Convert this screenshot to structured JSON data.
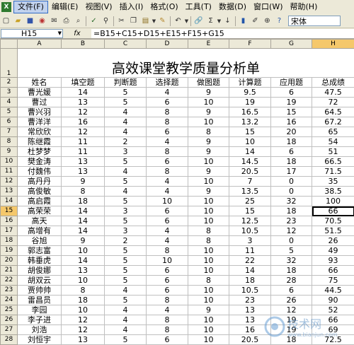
{
  "menu": [
    "文件(F)",
    "编辑(E)",
    "视图(V)",
    "插入(I)",
    "格式(O)",
    "工具(T)",
    "数据(D)",
    "窗口(W)",
    "帮助(H)"
  ],
  "toolbar": {
    "font_name": "宋体",
    "sigma": "Σ"
  },
  "formula_bar": {
    "name_box": "H15",
    "fx": "fx",
    "formula": "=B15+C15+D15+E15+F15+G15"
  },
  "columns": [
    "A",
    "B",
    "C",
    "D",
    "E",
    "F",
    "G",
    "H"
  ],
  "selected_column": "H",
  "selected_row": 15,
  "sheet": {
    "title": "高效课堂教学质量分析单",
    "headers": [
      "姓名",
      "填空题",
      "判断题",
      "选择题",
      "做图题",
      "计算题",
      "应用题",
      "总成绩"
    ],
    "rows": [
      [
        "曹光媛",
        "14",
        "5",
        "4",
        "9",
        "9.5",
        "6",
        "47.5"
      ],
      [
        "曹过",
        "13",
        "5",
        "6",
        "10",
        "19",
        "19",
        "72"
      ],
      [
        "曹兴羽",
        "12",
        "4",
        "8",
        "9",
        "16.5",
        "15",
        "64.5"
      ],
      [
        "曹洋洋",
        "16",
        "4",
        "8",
        "10",
        "13.2",
        "16",
        "67.2"
      ],
      [
        "常欣欣",
        "12",
        "4",
        "6",
        "8",
        "15",
        "20",
        "65"
      ],
      [
        "陈继霞",
        "11",
        "2",
        "4",
        "9",
        "10",
        "18",
        "54"
      ],
      [
        "杜梦梦",
        "11",
        "3",
        "8",
        "9",
        "14",
        "6",
        "51"
      ],
      [
        "樊金涛",
        "13",
        "5",
        "6",
        "10",
        "14.5",
        "18",
        "66.5"
      ],
      [
        "付魏伟",
        "13",
        "4",
        "8",
        "9",
        "20.5",
        "17",
        "71.5"
      ],
      [
        "高丹丹",
        "9",
        "5",
        "4",
        "10",
        "7",
        "0",
        "35"
      ],
      [
        "高俊敏",
        "8",
        "4",
        "4",
        "9",
        "13.5",
        "0",
        "38.5"
      ],
      [
        "高启霞",
        "18",
        "5",
        "10",
        "10",
        "25",
        "32",
        "100"
      ],
      [
        "高荣荣",
        "14",
        "3",
        "6",
        "10",
        "15",
        "18",
        "66"
      ],
      [
        "高天",
        "14",
        "5",
        "6",
        "10",
        "12.5",
        "23",
        "70.5"
      ],
      [
        "高增有",
        "14",
        "3",
        "4",
        "8",
        "10.5",
        "12",
        "51.5"
      ],
      [
        "谷旭",
        "9",
        "2",
        "4",
        "8",
        "3",
        "0",
        "26"
      ],
      [
        "郭志富",
        "10",
        "5",
        "8",
        "10",
        "11",
        "5",
        "49"
      ],
      [
        "韩垂虎",
        "14",
        "5",
        "10",
        "10",
        "22",
        "32",
        "93"
      ],
      [
        "胡俊娜",
        "13",
        "5",
        "6",
        "10",
        "14",
        "18",
        "66"
      ],
      [
        "胡双云",
        "10",
        "5",
        "6",
        "8",
        "18",
        "28",
        "75"
      ],
      [
        "贾帅帅",
        "8",
        "4",
        "6",
        "10",
        "10.5",
        "6",
        "44.5"
      ],
      [
        "雷昌员",
        "18",
        "5",
        "8",
        "10",
        "23",
        "26",
        "90"
      ],
      [
        "李园",
        "10",
        "4",
        "4",
        "9",
        "13",
        "12",
        "52"
      ],
      [
        "李子进",
        "12",
        "4",
        "8",
        "10",
        "13",
        "19",
        "66"
      ],
      [
        "刘浩",
        "12",
        "4",
        "8",
        "10",
        "16",
        "19",
        "69"
      ],
      [
        "刘恒宇",
        "13",
        "5",
        "6",
        "10",
        "20.5",
        "18",
        "72.5"
      ]
    ]
  },
  "watermark": {
    "text": "技术网",
    "url": "www.bianjun.com"
  }
}
